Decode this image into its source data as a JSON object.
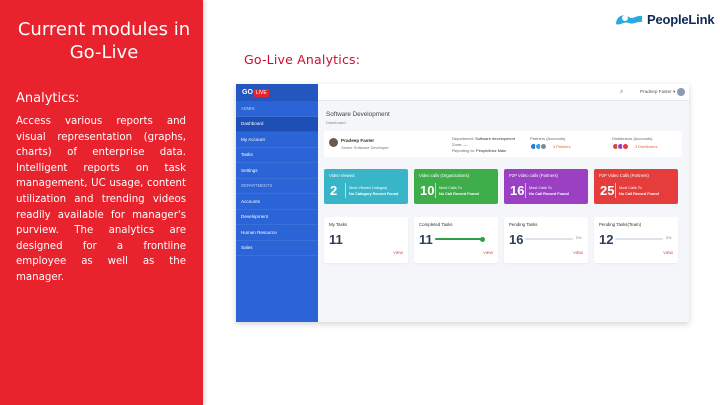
{
  "left_panel": {
    "title": "Current modules in Go-Live",
    "heading": "Analytics:",
    "body": "Access various reports and visual representation (graphs, charts) of enterprise data. Intelligent reports on task management, UC usage, content utilization and trending videos readily available for manager's purview. The analytics are designed for a frontline employee as well as the manager."
  },
  "brand": {
    "logo_text": "PeopleLink",
    "accent": "#e8232d",
    "logo_blue": "#2aa8e0"
  },
  "slide_heading": "Go-Live Analytics:",
  "app": {
    "sidebar": {
      "logo_go": "GO",
      "logo_live": "LIVE",
      "items": [
        {
          "label": "ADMIN",
          "muted": true
        },
        {
          "label": "Dashboard",
          "active": true
        },
        {
          "label": "My Account"
        },
        {
          "label": "Tasks"
        },
        {
          "label": "Settings"
        },
        {
          "label": "DEPARTMENTS",
          "muted": true
        },
        {
          "label": "Accounts"
        },
        {
          "label": "Development"
        },
        {
          "label": "Human Resource"
        },
        {
          "label": "Sales"
        }
      ]
    },
    "topbar": {
      "search_icon": "search-icon",
      "user_label": "Pradeep Faster ▾"
    },
    "page": {
      "title": "Software Development",
      "subtitle": "Dashboard"
    },
    "profile": {
      "name": "Pradeep Faster",
      "role": "Senior Software Developer",
      "dept_label": "Department:",
      "dept_value": "Software development",
      "zone_label": "Zone: —",
      "reporting_label": "Reporting to:",
      "reporting_value": "Peoplelinkz Main",
      "partners_label": "Partners (Accounts)",
      "partners_count": "3 Partners",
      "distributors_label": "Distributors (Accounts)",
      "distributors_count": "3 Distributors"
    },
    "stats": [
      {
        "title": "Video Viewed",
        "number": "2",
        "line1": "Most Viewed Category",
        "line2": "No Category Record Found",
        "color": "#39b5c9"
      },
      {
        "title": "Video calls (Organizations)",
        "number": "10",
        "line1": "Most Calls To",
        "line2": "No Call Record Found",
        "color": "#3eae4a"
      },
      {
        "title": "P2P Video calls (Partners)",
        "number": "16",
        "line1": "Most Calls To",
        "line2": "No Call Record Found",
        "color": "#9b3fc3"
      },
      {
        "title": "P2P Video Calls (Partners)",
        "number": "25",
        "line1": "Most Calls To",
        "line2": "No Call Record Found",
        "color": "#e53c3c"
      }
    ],
    "tasks": [
      {
        "title": "My Tasks",
        "number": "11",
        "progress": null,
        "pct": "",
        "view": "VIEW"
      },
      {
        "title": "Completed Tasks",
        "number": "11",
        "progress": 1.0,
        "pct": "",
        "view": "VIEW"
      },
      {
        "title": "Pending Tasks",
        "number": "16",
        "progress": 0.0,
        "pct": "0%",
        "view": "VIEW"
      },
      {
        "title": "Pending Tasks(Team)",
        "number": "12",
        "progress": 0.0,
        "pct": "0%",
        "view": "VIEW"
      }
    ]
  }
}
